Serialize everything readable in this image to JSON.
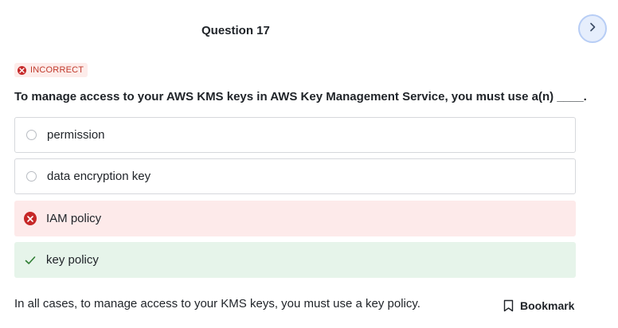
{
  "question": {
    "title": "Question 17",
    "status": "INCORRECT",
    "text": "To manage access to your AWS KMS keys in AWS Key Management Service, you must use a(n) ____."
  },
  "options": [
    {
      "label": "permission",
      "state": "unselected"
    },
    {
      "label": "data encryption key",
      "state": "unselected"
    },
    {
      "label": "IAM policy",
      "state": "incorrect"
    },
    {
      "label": "key policy",
      "state": "correct"
    }
  ],
  "explanation": "In all cases, to manage access to your KMS keys, you must use a key policy.",
  "bookmark_label": "Bookmark",
  "icons": {
    "next": "chevron-right-icon",
    "incorrect": "x-circle-icon",
    "correct": "check-icon",
    "bookmark": "bookmark-icon",
    "radio": "radio-circle-icon"
  },
  "colors": {
    "incorrect_red": "#c62828",
    "incorrect_bg": "#fdeaea",
    "correct_green": "#2e7d32",
    "correct_bg": "#e6f4ea",
    "next_button_bg": "#e6eefc"
  }
}
